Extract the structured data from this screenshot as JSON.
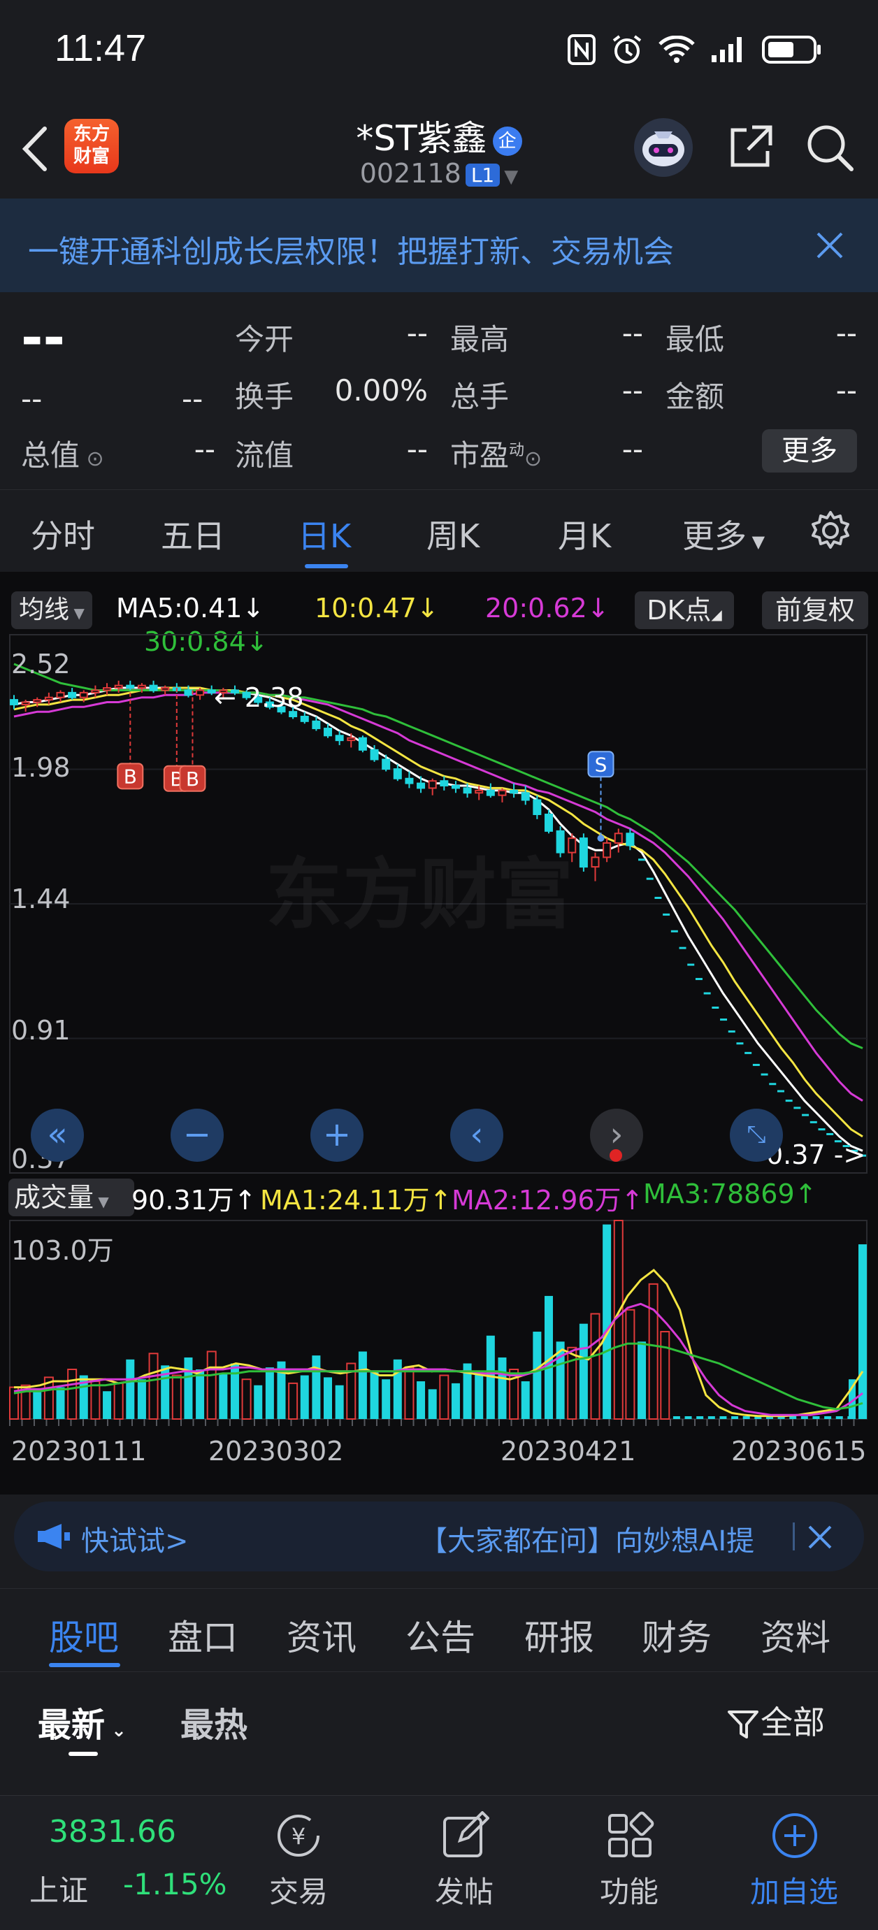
{
  "status_bar": {
    "time": "11:47"
  },
  "header": {
    "title": "*ST紫鑫",
    "qi_badge": "企",
    "code": "002118",
    "level_tag": "L1",
    "logo_text": "东方财富"
  },
  "banner": {
    "text": "一键开通科创成长层权限！把握打新、交易机会"
  },
  "quote": {
    "price": "--",
    "change": "--",
    "change_pct": "--",
    "fields": [
      {
        "label": "今开",
        "value": "--"
      },
      {
        "label": "最高",
        "value": "--"
      },
      {
        "label": "最低",
        "value": "--"
      },
      {
        "label": "换手",
        "value": "0.00%"
      },
      {
        "label": "总手",
        "value": "--"
      },
      {
        "label": "金额",
        "value": "--"
      },
      {
        "label": "总值",
        "value": "--"
      },
      {
        "label": "流值",
        "value": "--"
      },
      {
        "label": "市盈",
        "value": "--",
        "superscript": "动"
      }
    ],
    "more_label": "更多"
  },
  "kline_tabs": [
    "分时",
    "五日",
    "日K",
    "周K",
    "月K",
    "更多"
  ],
  "kline_active": "日K",
  "indicator": {
    "ma_select": "均线",
    "ma5": "MA5:0.41↓",
    "ma10": "10:0.47↓",
    "ma20": "20:0.62↓",
    "ma30": "30:0.84↓",
    "dk_label": "DK点",
    "fq_label": "前复权"
  },
  "colors": {
    "up": "#e03a3a",
    "down": "#1fd6df",
    "ma5": "#ffffff",
    "ma10": "#f4e542",
    "ma20": "#d63ad6",
    "ma30": "#2fbf3a",
    "accent": "#3b84f0",
    "fall": "#2fe07a"
  },
  "price_axis": [
    "2.52",
    "1.98",
    "1.44",
    "0.91",
    "0.37"
  ],
  "chart_annotations": {
    "high_mark": "2.38",
    "low_mark": "0.37",
    "watermark": "东方财富",
    "buy": "B",
    "sell": "S"
  },
  "volume": {
    "select": "成交量",
    "vol": "90.31万↑",
    "ma1": "MA1:24.11万↑",
    "ma2": "MA2:12.96万↑",
    "ma3": "MA3:78869↑",
    "axis_top": "103.0万"
  },
  "date_axis": [
    "20230111",
    "20230302",
    "20230421",
    "20230615"
  ],
  "ad": {
    "left": "快试试>",
    "right": "【大家都在问】向妙想AI提"
  },
  "bottom_tabs": [
    "股吧",
    "盘口",
    "资讯",
    "公告",
    "研报",
    "财务",
    "资料"
  ],
  "bottom_active": "股吧",
  "sort": {
    "newest": "最新",
    "hottest": "最热",
    "filter": "全部"
  },
  "footer": {
    "index_value": "3831.66",
    "index_name": "上证",
    "index_pct": "-1.15%",
    "items": [
      "交易",
      "发帖",
      "功能",
      "加自选"
    ]
  },
  "chart_data": {
    "type": "candlestick",
    "title": "",
    "ylim": [
      0.37,
      2.52
    ],
    "x_ticks": [
      "20230111",
      "20230302",
      "20230421",
      "20230615"
    ],
    "candles": [
      [
        2.3,
        2.32,
        2.26,
        2.28
      ],
      [
        2.28,
        2.3,
        2.25,
        2.29
      ],
      [
        2.29,
        2.31,
        2.27,
        2.3
      ],
      [
        2.3,
        2.33,
        2.28,
        2.31
      ],
      [
        2.31,
        2.34,
        2.29,
        2.33
      ],
      [
        2.33,
        2.35,
        2.3,
        2.31
      ],
      [
        2.31,
        2.34,
        2.29,
        2.33
      ],
      [
        2.33,
        2.36,
        2.31,
        2.34
      ],
      [
        2.34,
        2.37,
        2.32,
        2.35
      ],
      [
        2.35,
        2.38,
        2.33,
        2.36
      ],
      [
        2.36,
        2.38,
        2.34,
        2.35
      ],
      [
        2.35,
        2.37,
        2.33,
        2.36
      ],
      [
        2.36,
        2.38,
        2.33,
        2.34
      ],
      [
        2.34,
        2.36,
        2.32,
        2.35
      ],
      [
        2.35,
        2.37,
        2.33,
        2.34
      ],
      [
        2.34,
        2.36,
        2.31,
        2.32
      ],
      [
        2.32,
        2.35,
        2.3,
        2.34
      ],
      [
        2.34,
        2.36,
        2.32,
        2.33
      ],
      [
        2.33,
        2.35,
        2.31,
        2.34
      ],
      [
        2.34,
        2.36,
        2.32,
        2.33
      ],
      [
        2.33,
        2.34,
        2.3,
        2.31
      ],
      [
        2.31,
        2.33,
        2.28,
        2.29
      ],
      [
        2.29,
        2.31,
        2.26,
        2.27
      ],
      [
        2.27,
        2.29,
        2.24,
        2.25
      ],
      [
        2.25,
        2.27,
        2.22,
        2.23
      ],
      [
        2.23,
        2.25,
        2.2,
        2.21
      ],
      [
        2.21,
        2.23,
        2.17,
        2.18
      ],
      [
        2.18,
        2.2,
        2.14,
        2.15
      ],
      [
        2.15,
        2.17,
        2.11,
        2.13
      ],
      [
        2.13,
        2.16,
        2.1,
        2.14
      ],
      [
        2.14,
        2.15,
        2.08,
        2.09
      ],
      [
        2.09,
        2.11,
        2.04,
        2.05
      ],
      [
        2.05,
        2.07,
        2.0,
        2.01
      ],
      [
        2.01,
        2.03,
        1.96,
        1.97
      ],
      [
        1.97,
        2.0,
        1.93,
        1.95
      ],
      [
        1.95,
        1.98,
        1.91,
        1.93
      ],
      [
        1.93,
        1.97,
        1.9,
        1.96
      ],
      [
        1.96,
        1.98,
        1.92,
        1.94
      ],
      [
        1.94,
        1.96,
        1.91,
        1.93
      ],
      [
        1.93,
        1.95,
        1.89,
        1.91
      ],
      [
        1.91,
        1.94,
        1.88,
        1.92
      ],
      [
        1.92,
        1.95,
        1.89,
        1.9
      ],
      [
        1.9,
        1.93,
        1.87,
        1.92
      ],
      [
        1.92,
        1.95,
        1.89,
        1.91
      ],
      [
        1.91,
        1.94,
        1.86,
        1.88
      ],
      [
        1.88,
        1.9,
        1.8,
        1.82
      ],
      [
        1.82,
        1.84,
        1.74,
        1.75
      ],
      [
        1.75,
        1.77,
        1.64,
        1.66
      ],
      [
        1.66,
        1.74,
        1.62,
        1.72
      ],
      [
        1.72,
        1.74,
        1.58,
        1.6
      ],
      [
        1.6,
        1.66,
        1.54,
        1.64
      ],
      [
        1.64,
        1.72,
        1.62,
        1.7
      ],
      [
        1.7,
        1.76,
        1.66,
        1.74
      ],
      [
        1.74,
        1.76,
        1.67,
        1.69
      ]
    ],
    "limit_down_dashes": [
      1.63,
      1.55,
      1.47,
      1.4,
      1.33,
      1.26,
      1.19,
      1.13,
      1.07,
      1.01,
      0.96,
      0.91,
      0.86,
      0.82,
      0.77,
      0.73,
      0.69,
      0.66,
      0.62,
      0.59,
      0.56,
      0.53,
      0.5,
      0.48,
      0.45,
      0.43,
      0.41,
      0.39
    ],
    "series": [
      {
        "name": "MA5",
        "values": [
          2.28,
          2.29,
          2.29,
          2.3,
          2.31,
          2.32,
          2.32,
          2.33,
          2.34,
          2.35,
          2.35,
          2.35,
          2.35,
          2.35,
          2.35,
          2.35,
          2.34,
          2.34,
          2.34,
          2.33,
          2.33,
          2.32,
          2.31,
          2.29,
          2.27,
          2.25,
          2.23,
          2.2,
          2.17,
          2.15,
          2.12,
          2.09,
          2.06,
          2.03,
          2.0,
          1.97,
          1.95,
          1.95,
          1.94,
          1.94,
          1.93,
          1.92,
          1.92,
          1.91,
          1.91,
          1.88,
          1.84,
          1.78,
          1.73,
          1.69,
          1.67,
          1.67,
          1.69,
          1.7,
          1.66,
          1.58,
          1.49,
          1.4,
          1.31,
          1.23,
          1.15,
          1.07,
          1.0,
          0.93,
          0.86,
          0.8,
          0.74,
          0.68,
          0.62,
          0.57,
          0.52,
          0.47,
          0.43,
          0.41
        ]
      },
      {
        "name": "MA10",
        "values": [
          2.26,
          2.27,
          2.28,
          2.28,
          2.29,
          2.3,
          2.3,
          2.31,
          2.32,
          2.32,
          2.33,
          2.34,
          2.34,
          2.35,
          2.35,
          2.35,
          2.35,
          2.34,
          2.34,
          2.34,
          2.33,
          2.33,
          2.32,
          2.31,
          2.3,
          2.28,
          2.26,
          2.24,
          2.22,
          2.19,
          2.17,
          2.14,
          2.11,
          2.08,
          2.05,
          2.02,
          2.0,
          1.98,
          1.97,
          1.95,
          1.94,
          1.93,
          1.93,
          1.92,
          1.92,
          1.9,
          1.88,
          1.85,
          1.82,
          1.78,
          1.75,
          1.72,
          1.7,
          1.69,
          1.67,
          1.63,
          1.57,
          1.5,
          1.43,
          1.35,
          1.27,
          1.2,
          1.12,
          1.05,
          0.98,
          0.91,
          0.84,
          0.78,
          0.71,
          0.65,
          0.6,
          0.55,
          0.5,
          0.47
        ]
      },
      {
        "name": "MA20",
        "values": [
          2.23,
          2.24,
          2.25,
          2.25,
          2.26,
          2.27,
          2.27,
          2.28,
          2.29,
          2.29,
          2.3,
          2.31,
          2.31,
          2.32,
          2.32,
          2.32,
          2.33,
          2.33,
          2.33,
          2.33,
          2.33,
          2.33,
          2.32,
          2.32,
          2.31,
          2.3,
          2.29,
          2.28,
          2.26,
          2.24,
          2.22,
          2.2,
          2.18,
          2.16,
          2.13,
          2.11,
          2.09,
          2.07,
          2.05,
          2.03,
          2.01,
          1.99,
          1.97,
          1.95,
          1.94,
          1.92,
          1.91,
          1.89,
          1.87,
          1.85,
          1.83,
          1.8,
          1.78,
          1.76,
          1.73,
          1.7,
          1.66,
          1.61,
          1.56,
          1.5,
          1.44,
          1.38,
          1.31,
          1.24,
          1.17,
          1.1,
          1.03,
          0.96,
          0.89,
          0.82,
          0.76,
          0.7,
          0.65,
          0.62
        ]
      },
      {
        "name": "MA30",
        "values": [
          2.45,
          2.43,
          2.41,
          2.39,
          2.37,
          2.36,
          2.35,
          2.34,
          2.34,
          2.34,
          2.34,
          2.34,
          2.34,
          2.34,
          2.34,
          2.34,
          2.34,
          2.34,
          2.34,
          2.33,
          2.33,
          2.33,
          2.32,
          2.32,
          2.31,
          2.31,
          2.3,
          2.29,
          2.28,
          2.27,
          2.26,
          2.24,
          2.23,
          2.21,
          2.19,
          2.17,
          2.15,
          2.13,
          2.11,
          2.09,
          2.07,
          2.05,
          2.03,
          2.01,
          1.99,
          1.97,
          1.95,
          1.93,
          1.91,
          1.89,
          1.87,
          1.85,
          1.82,
          1.8,
          1.77,
          1.74,
          1.7,
          1.66,
          1.62,
          1.57,
          1.52,
          1.47,
          1.42,
          1.36,
          1.3,
          1.24,
          1.18,
          1.12,
          1.06,
          1.0,
          0.95,
          0.9,
          0.86,
          0.84
        ]
      }
    ],
    "volume_bars": [
      [
        0.16,
        1
      ],
      [
        0.17,
        1
      ],
      [
        0.15,
        0
      ],
      [
        0.21,
        1
      ],
      [
        0.16,
        0
      ],
      [
        0.25,
        1
      ],
      [
        0.22,
        0
      ],
      [
        0.19,
        1
      ],
      [
        0.14,
        0
      ],
      [
        0.18,
        1
      ],
      [
        0.3,
        0
      ],
      [
        0.2,
        0
      ],
      [
        0.33,
        1
      ],
      [
        0.27,
        0
      ],
      [
        0.22,
        1
      ],
      [
        0.31,
        0
      ],
      [
        0.25,
        0
      ],
      [
        0.34,
        1
      ],
      [
        0.23,
        0
      ],
      [
        0.28,
        0
      ],
      [
        0.2,
        1
      ],
      [
        0.17,
        0
      ],
      [
        0.26,
        0
      ],
      [
        0.29,
        0
      ],
      [
        0.18,
        1
      ],
      [
        0.22,
        0
      ],
      [
        0.32,
        0
      ],
      [
        0.21,
        0
      ],
      [
        0.17,
        0
      ],
      [
        0.28,
        1
      ],
      [
        0.34,
        0
      ],
      [
        0.24,
        0
      ],
      [
        0.2,
        0
      ],
      [
        0.3,
        0
      ],
      [
        0.26,
        1
      ],
      [
        0.19,
        0
      ],
      [
        0.15,
        0
      ],
      [
        0.22,
        1
      ],
      [
        0.18,
        0
      ],
      [
        0.28,
        0
      ],
      [
        0.24,
        0
      ],
      [
        0.42,
        0
      ],
      [
        0.31,
        0
      ],
      [
        0.25,
        1
      ],
      [
        0.19,
        0
      ],
      [
        0.44,
        0
      ],
      [
        0.62,
        0
      ],
      [
        0.39,
        0
      ],
      [
        0.36,
        1
      ],
      [
        0.48,
        0
      ],
      [
        0.53,
        1
      ],
      [
        0.98,
        0
      ],
      [
        1.0,
        1
      ],
      [
        0.55,
        1
      ],
      [
        0.39,
        0
      ],
      [
        0.68,
        1
      ],
      [
        0.44,
        1
      ]
    ],
    "volume_ma": [
      {
        "name": "MA1",
        "values": [
          0.16,
          0.16,
          0.17,
          0.19,
          0.19,
          0.2,
          0.2,
          0.2,
          0.18,
          0.19,
          0.22,
          0.24,
          0.26,
          0.25,
          0.23,
          0.26,
          0.26,
          0.28,
          0.27,
          0.25,
          0.24,
          0.23,
          0.24,
          0.26,
          0.24,
          0.23,
          0.24,
          0.25,
          0.22,
          0.22,
          0.26,
          0.27,
          0.24,
          0.25,
          0.24,
          0.23,
          0.22,
          0.21,
          0.2,
          0.22,
          0.25,
          0.3,
          0.35,
          0.32,
          0.3,
          0.38,
          0.5,
          0.62,
          0.7,
          0.75,
          0.68,
          0.55,
          0.3,
          0.12,
          0.06,
          0.03,
          0.02,
          0.015,
          0.015,
          0.015,
          0.02,
          0.03,
          0.04,
          0.05,
          0.14,
          0.24
        ]
      },
      {
        "name": "MA2",
        "values": [
          0.14,
          0.15,
          0.15,
          0.16,
          0.17,
          0.18,
          0.19,
          0.2,
          0.2,
          0.2,
          0.21,
          0.22,
          0.23,
          0.24,
          0.24,
          0.25,
          0.25,
          0.26,
          0.26,
          0.25,
          0.25,
          0.25,
          0.25,
          0.25,
          0.24,
          0.24,
          0.24,
          0.24,
          0.24,
          0.24,
          0.25,
          0.25,
          0.25,
          0.25,
          0.24,
          0.24,
          0.23,
          0.23,
          0.22,
          0.22,
          0.24,
          0.28,
          0.32,
          0.35,
          0.36,
          0.41,
          0.5,
          0.56,
          0.58,
          0.55,
          0.48,
          0.4,
          0.3,
          0.2,
          0.12,
          0.07,
          0.04,
          0.03,
          0.02,
          0.02,
          0.02,
          0.02,
          0.03,
          0.04,
          0.08,
          0.13
        ]
      },
      {
        "name": "MA3",
        "values": [
          0.13,
          0.14,
          0.14,
          0.15,
          0.15,
          0.16,
          0.17,
          0.17,
          0.18,
          0.19,
          0.19,
          0.2,
          0.21,
          0.21,
          0.22,
          0.22,
          0.23,
          0.23,
          0.24,
          0.24,
          0.24,
          0.24,
          0.24,
          0.24,
          0.24,
          0.24,
          0.24,
          0.24,
          0.24,
          0.24,
          0.24,
          0.24,
          0.24,
          0.24,
          0.24,
          0.24,
          0.24,
          0.24,
          0.23,
          0.23,
          0.24,
          0.26,
          0.28,
          0.3,
          0.31,
          0.33,
          0.36,
          0.38,
          0.38,
          0.37,
          0.36,
          0.34,
          0.32,
          0.3,
          0.28,
          0.25,
          0.22,
          0.19,
          0.16,
          0.13,
          0.1,
          0.08,
          0.06,
          0.05,
          0.06,
          0.08
        ]
      }
    ]
  }
}
